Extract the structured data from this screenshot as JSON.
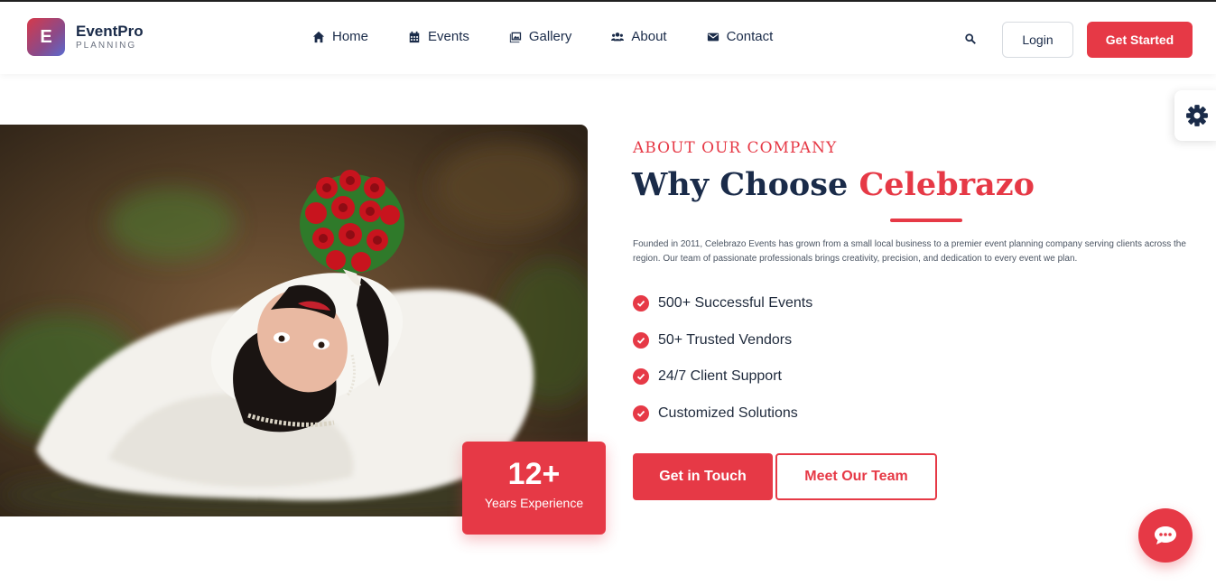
{
  "brand": {
    "initial": "E",
    "name": "EventPro",
    "tagline": "PLANNING"
  },
  "nav": [
    {
      "label": "Home",
      "icon": "home-icon"
    },
    {
      "label": "Events",
      "icon": "calendar-icon"
    },
    {
      "label": "Gallery",
      "icon": "images-icon"
    },
    {
      "label": "About",
      "icon": "users-icon"
    },
    {
      "label": "Contact",
      "icon": "envelope-icon"
    }
  ],
  "header_actions": {
    "login_label": "Login",
    "cta_label": "Get Started"
  },
  "hero": {
    "experience_number": "12+",
    "experience_label": "Years Experience"
  },
  "about": {
    "eyebrow": "ABOUT OUR COMPANY",
    "heading_plain": "Why Choose ",
    "heading_accent": "Celebrazo",
    "description": "Founded in 2011, Celebrazo Events has grown from a small local business to a premier event planning company serving clients across the region. Our team of passionate professionals brings creativity, precision, and dedication to every event we plan.",
    "features": [
      "500+ Successful Events",
      "50+ Trusted Vendors",
      "24/7 Client Support",
      "Customized Solutions"
    ],
    "primary_button": "Get in Touch",
    "secondary_button": "Meet Our Team"
  },
  "colors": {
    "accent": "#e63946",
    "navy": "#1a2b49"
  }
}
